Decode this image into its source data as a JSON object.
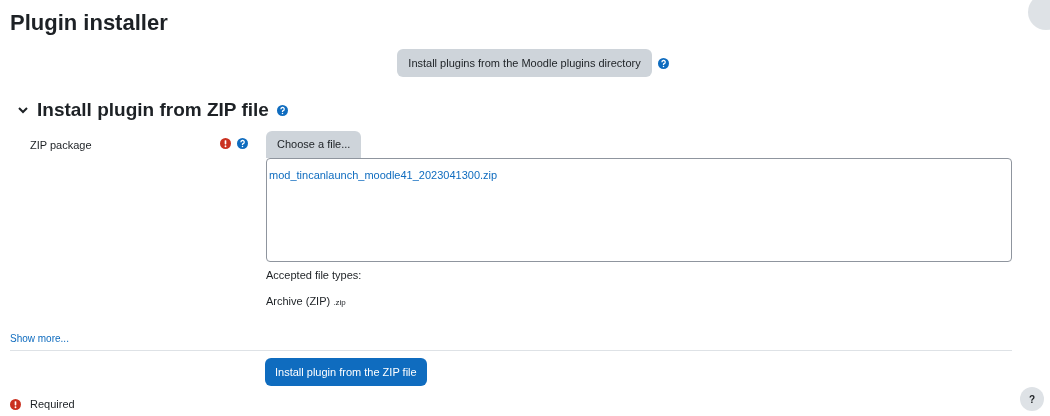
{
  "page_title": "Plugin installer",
  "directory_button": {
    "label": "Install plugins from the Moodle plugins directory"
  },
  "section": {
    "title": "Install plugin from ZIP file",
    "expanded": true
  },
  "zip_field": {
    "label": "ZIP package",
    "required": true,
    "choose_button": "Choose a file...",
    "file_name": "mod_tincanlaunch_moodle41_2023041300.zip",
    "accepted_label": "Accepted file types:",
    "accepted_type": "Archive (ZIP)",
    "accepted_ext": ".zip"
  },
  "show_more": "Show more...",
  "submit_button": "Install plugin from the ZIP file",
  "required_note": "Required",
  "help_button": "?"
}
